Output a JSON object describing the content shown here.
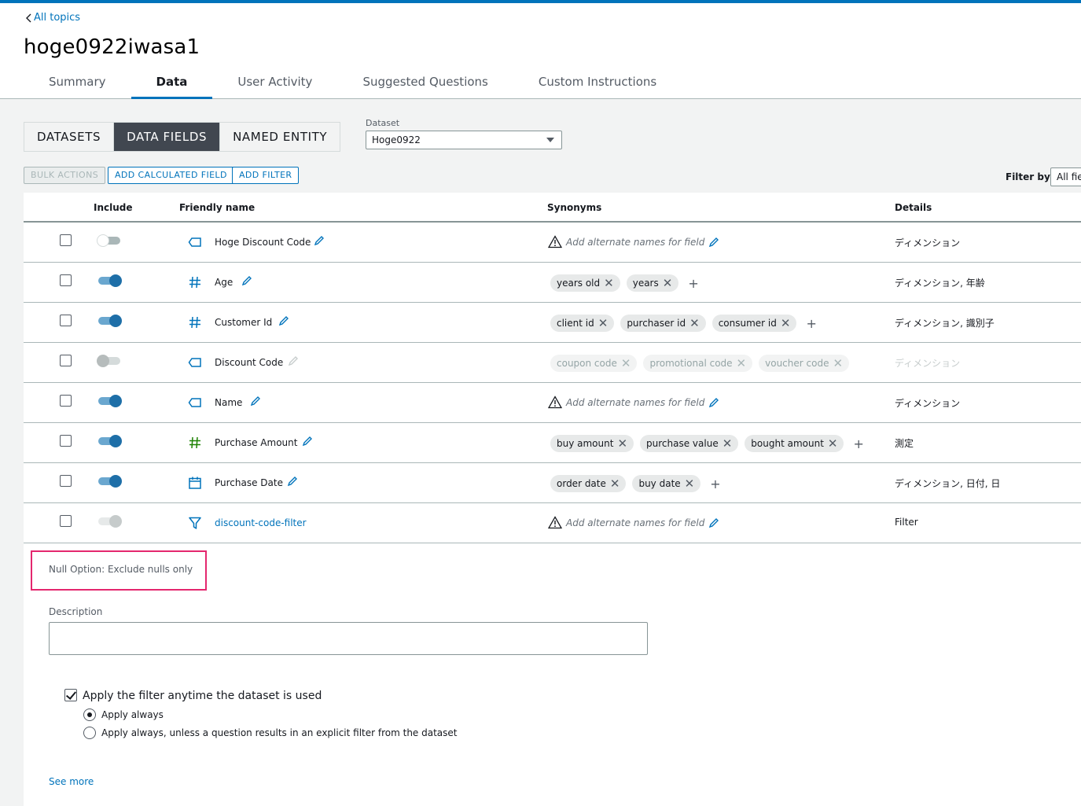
{
  "header": {
    "back_link": "All topics",
    "title": "hoge0922iwasa1",
    "tabs": [
      {
        "label": "Summary"
      },
      {
        "label": "Data"
      },
      {
        "label": "User Activity"
      },
      {
        "label": "Suggested Questions"
      },
      {
        "label": "Custom Instructions"
      }
    ],
    "active_tab": "Data"
  },
  "view_switch": {
    "options": [
      "DATASETS",
      "DATA FIELDS",
      "NAMED ENTITY"
    ],
    "selected": "DATA FIELDS"
  },
  "dataset": {
    "label": "Dataset",
    "value": "Hoge0922"
  },
  "toolbar": {
    "bulk_actions": "BULK ACTIONS",
    "add_calculated_field": "ADD CALCULATED FIELD",
    "add_filter": "ADD FILTER",
    "filter_by_label": "Filter by:",
    "filter_by_value": "All fie"
  },
  "table": {
    "columns": {
      "include": "Include",
      "friendly_name": "Friendly name",
      "synonyms": "Synonyms",
      "details": "Details"
    },
    "empty_synonym_text": "Add alternate names for field",
    "rows": [
      {
        "name": "Hoge Discount Code",
        "type_icon": "dimension-tag-icon",
        "include": "off",
        "synonyms": [],
        "details": "ディメンション"
      },
      {
        "name": "Age",
        "type_icon": "hash-icon",
        "include": "on",
        "synonyms": [
          "years old",
          "years"
        ],
        "details": "ディメンション, 年齢"
      },
      {
        "name": "Customer Id",
        "type_icon": "hash-icon",
        "include": "on",
        "synonyms": [
          "client id",
          "purchaser id",
          "consumer id"
        ],
        "details": "ディメンション, 識別子"
      },
      {
        "name": "Discount Code",
        "type_icon": "dimension-tag-icon",
        "include": "disabled",
        "synonyms": [
          "coupon code",
          "promotional code",
          "voucher code"
        ],
        "details": "ディメンション"
      },
      {
        "name": "Name",
        "type_icon": "dimension-tag-icon",
        "include": "on",
        "synonyms": [],
        "details": "ディメンション"
      },
      {
        "name": "Purchase Amount",
        "type_icon": "measure-hash-icon",
        "include": "on",
        "synonyms": [
          "buy amount",
          "purchase value",
          "bought amount"
        ],
        "details": "測定"
      },
      {
        "name": "Purchase Date",
        "type_icon": "calendar-icon",
        "include": "on",
        "synonyms": [
          "order date",
          "buy date"
        ],
        "details": "ディメンション, 日付, 日"
      },
      {
        "name": "discount-code-filter",
        "type_icon": "filter-icon",
        "include": "disabled-on",
        "synonyms": [],
        "details": "Filter"
      }
    ]
  },
  "filter_detail": {
    "null_option": "Null Option: Exclude nulls only",
    "description_label": "Description",
    "description_value": "",
    "apply_checkbox_label": "Apply the filter anytime the dataset is used",
    "apply_checked": true,
    "radio_options": [
      "Apply always",
      "Apply always, unless a question results in an explicit filter from the dataset"
    ],
    "radio_selected": 0,
    "see_more": "See more"
  },
  "colors": {
    "accent": "#0073bb",
    "highlight_border": "#e4276e",
    "toggle_on": "#1e6fa8",
    "measure_icon": "#1d8102"
  }
}
